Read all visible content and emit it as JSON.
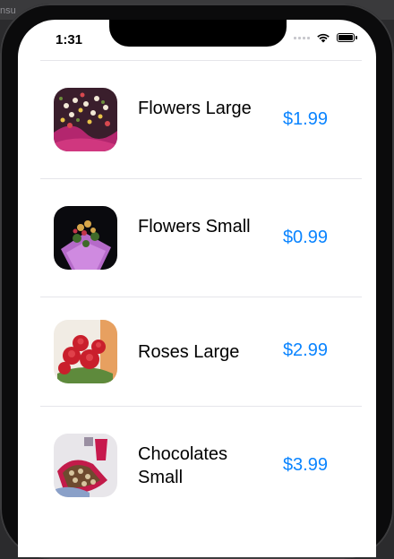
{
  "status_bar": {
    "time": "1:31"
  },
  "background_fragment": "nsu",
  "colors": {
    "accent": "#0a84ff",
    "divider": "#e5e5ea"
  },
  "products": [
    {
      "name": "Flowers Large",
      "price": "$1.99",
      "image": "flowers-large-photo"
    },
    {
      "name": "Flowers Small",
      "price": "$0.99",
      "image": "flowers-small-photo"
    },
    {
      "name": "Roses Large",
      "price": "$2.99",
      "image": "roses-large-photo"
    },
    {
      "name": "Chocolates Small",
      "price": "$3.99",
      "image": "chocolates-small-photo"
    }
  ]
}
